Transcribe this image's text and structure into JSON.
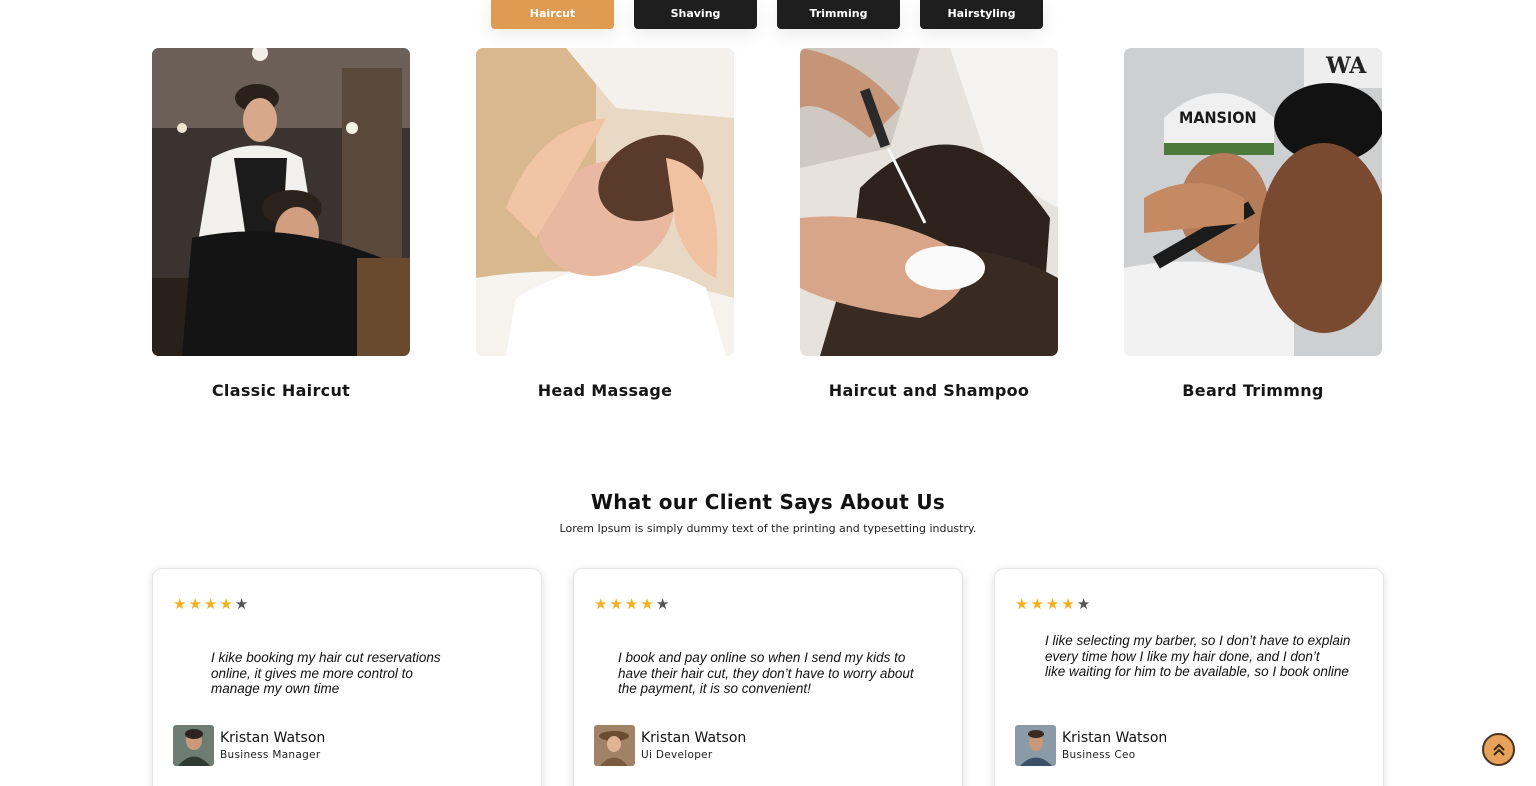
{
  "tabs": [
    {
      "label": "Haircut",
      "active": true
    },
    {
      "label": "Shaving",
      "active": false
    },
    {
      "label": "Trimming",
      "active": false
    },
    {
      "label": "Hairstyling",
      "active": false
    }
  ],
  "services": [
    {
      "title": "Classic Haircut"
    },
    {
      "title": "Head Massage"
    },
    {
      "title": "Haircut and Shampoo"
    },
    {
      "title": "Beard Trimmng"
    }
  ],
  "testimonials_section": {
    "heading": "What our Client Says About Us",
    "subheading": "Lorem Ipsum is simply dummy text of the printing and typesetting industry."
  },
  "testimonials": [
    {
      "rating": 4,
      "max_rating": 5,
      "quote": [
        "I kike booking my hair cut reservations",
        "online, it gives me more control to",
        "manage my own time"
      ],
      "name": "Kristan Watson",
      "role": "Business Manager"
    },
    {
      "rating": 4,
      "max_rating": 5,
      "quote": [
        "I book and pay online so when I send my kids to",
        "have their hair cut, they don’t have to worry about",
        "the payment, it is so convenient!"
      ],
      "name": "Kristan Watson",
      "role": "Ui Developer"
    },
    {
      "rating": 4,
      "max_rating": 5,
      "quote": [
        "I like selecting my barber, so I don’t have to explain",
        "every time how I like my hair done, and I don’t",
        "like waiting for him to be available, so I book online"
      ],
      "name": "Kristan Watson",
      "role": "Business Ceo"
    }
  ],
  "image_text": {
    "wall_sign": "WA",
    "cap_text": "MANSION"
  },
  "icons": {
    "star": "star-icon",
    "scroll_top": "double-chevron-up-icon"
  },
  "colors": {
    "accent": "#e09b53",
    "tab_dark": "#1e1e1e",
    "star": "#f2b01e",
    "star_off": "#555555"
  }
}
